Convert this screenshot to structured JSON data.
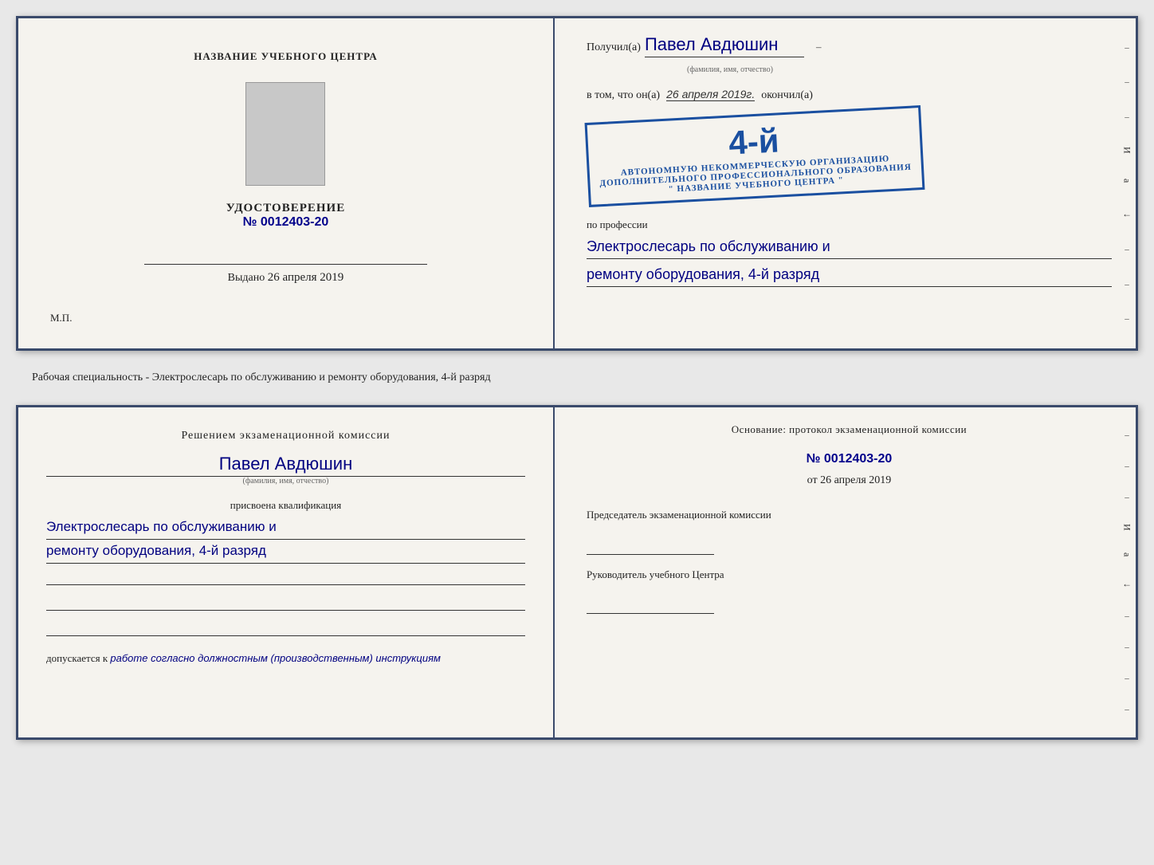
{
  "top_doc": {
    "left": {
      "center_title": "НАЗВАНИЕ УЧЕБНОГО ЦЕНТРА",
      "cert_title": "УДОСТОВЕРЕНИЕ",
      "cert_number": "№ 0012403-20",
      "issued_label": "Выдано",
      "issued_date": "26 апреля 2019",
      "mp_label": "М.П."
    },
    "right": {
      "recipient_label": "Получил(а)",
      "recipient_name": "Павел Авдюшин",
      "fio_hint": "(фамилия, имя, отчество)",
      "vtom_label": "в том, что он(а)",
      "vtom_date": "26 апреля 2019г.",
      "okonchil_label": "окончил(а)",
      "stamp_number": "4-й",
      "stamp_line1": "АВТОНОМНУЮ НЕКОММЕРЧЕСКУЮ ОРГАНИЗАЦИЮ",
      "stamp_line2": "ДОПОЛНИТЕЛЬНОГО ПРОФЕССИОНАЛЬНОГО ОБРАЗОВАНИЯ",
      "stamp_line3": "\" НАЗВАНИЕ УЧЕБНОГО ЦЕНТРА \"",
      "profession_label": "по профессии",
      "profession_line1": "Электрослесарь по обслуживанию и",
      "profession_line2": "ремонту оборудования, 4-й разряд"
    }
  },
  "middle_text": "Рабочая специальность - Электрослесарь по обслуживанию и ремонту оборудования, 4-й разряд",
  "bottom_doc": {
    "left": {
      "komissia_title": "Решением экзаменационной комиссии",
      "name": "Павел Авдюшин",
      "fio_hint": "(фамилия, имя, отчество)",
      "kvalif_label": "присвоена квалификация",
      "kvalif_line1": "Электрослесарь по обслуживанию и",
      "kvalif_line2": "ремонту оборудования, 4-й разряд",
      "dopusk_label": "допускается к",
      "dopusk_text": "работе согласно должностным (производственным) инструкциям"
    },
    "right": {
      "osnovaniye_label": "Основание: протокол экзаменационной комиссии",
      "protocol_number": "№ 0012403-20",
      "date_from_label": "от",
      "date_from": "26 апреля 2019",
      "predsedatel_label": "Председатель экзаменационной комиссии",
      "rukovoditel_label": "Руководитель учебного Центра"
    }
  },
  "side_labels": {
    "i": "И",
    "a": "а",
    "arrow": "←",
    "dashes": [
      "–",
      "–",
      "–",
      "–",
      "–",
      "–",
      "–"
    ]
  }
}
